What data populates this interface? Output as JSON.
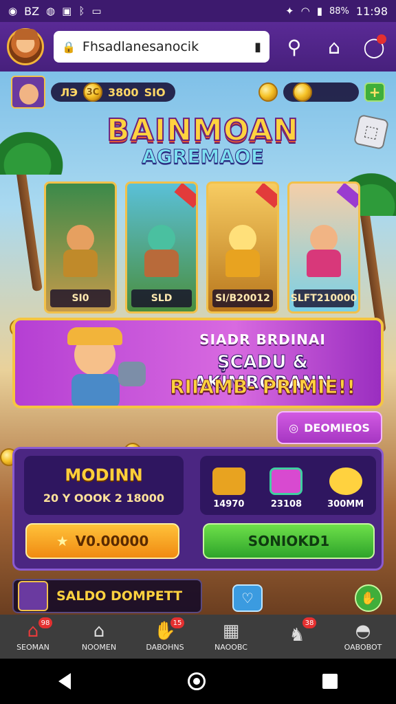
{
  "status_bar": {
    "left_text": "BZ",
    "battery": "88%",
    "time": "11:98"
  },
  "browser": {
    "url": "Fhsadlanesanocik"
  },
  "hud": {
    "pill1_left": "ЛЭ",
    "pill1_coin": "3C",
    "pill1_mid": "3800",
    "pill1_right": "SIO",
    "add_symbol": "+"
  },
  "logo": {
    "line1": "BAINMOAN",
    "line2": "AGREMAOE"
  },
  "cards": [
    {
      "label": "SI0",
      "color": "#3b8a4a"
    },
    {
      "label": "SLD",
      "color": "#5ac0d8"
    },
    {
      "label": "SI/B20012",
      "color": "#f7cc62"
    },
    {
      "label": "SLFT210000",
      "color": "#f5cfa8"
    }
  ],
  "promo": {
    "line1": "SIADR BRDINAI",
    "line2": "ŞCADU & AKIMRORANN",
    "line3": "RIIAMB- PRIMIE!!"
  },
  "promo_button": {
    "label": "DEOMIEOS"
  },
  "panel": {
    "left_title": "MODINN",
    "left_amount": "20 Y OOOK 2 18000",
    "prizes": [
      {
        "label": "14970",
        "color": "#e8a320"
      },
      {
        "label": "23108",
        "color": "#d84ad0"
      },
      {
        "label": "300MM",
        "color": "#ffd23f"
      }
    ],
    "gold_button": "V0.00000",
    "green_button": "SONIOKD1"
  },
  "saldo": {
    "label": "SALDO DOMPETT"
  },
  "bottom_nav": [
    {
      "label": "SEOMAN",
      "badge": "98",
      "icon": "home-icon"
    },
    {
      "label": "NOOMEN",
      "badge": "",
      "icon": "store-icon"
    },
    {
      "label": "DABOHNS",
      "badge": "15",
      "icon": "hand-icon"
    },
    {
      "label": "NAOOBC",
      "badge": "",
      "icon": "grid-icon"
    },
    {
      "label": "",
      "badge": "38",
      "icon": "elephant-icon"
    },
    {
      "label": "OABOBOT",
      "badge": "",
      "icon": "profile-icon"
    }
  ],
  "colors": {
    "brand_purple": "#47207c",
    "accent_gold": "#f5c542",
    "accent_green": "#3fae3a"
  }
}
